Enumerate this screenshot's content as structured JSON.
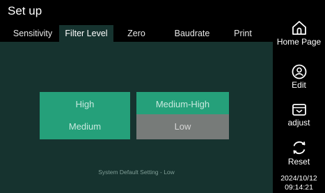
{
  "window": {
    "title": "Set up"
  },
  "tabs": [
    {
      "label": "Sensitivity"
    },
    {
      "label": "Filter Level"
    },
    {
      "label": "Zero"
    },
    {
      "label": "Baudrate"
    },
    {
      "label": "Print"
    }
  ],
  "filter_level": {
    "options": [
      {
        "label": "High"
      },
      {
        "label": "Medium-High"
      },
      {
        "label": "Medium"
      },
      {
        "label": "Low"
      }
    ],
    "selected": "Low",
    "note": "System Default Setting - Low"
  },
  "sidebar": {
    "home_label": "Home Page",
    "edit_label": "Edit",
    "adjust_label": "adjust",
    "reset_label": "Reset",
    "date": "2024/10/12",
    "time": "09:14:21"
  },
  "colors": {
    "background": "#000000",
    "panel": "#16332f",
    "option": "#25a07a",
    "selected_option": "#777b79"
  }
}
